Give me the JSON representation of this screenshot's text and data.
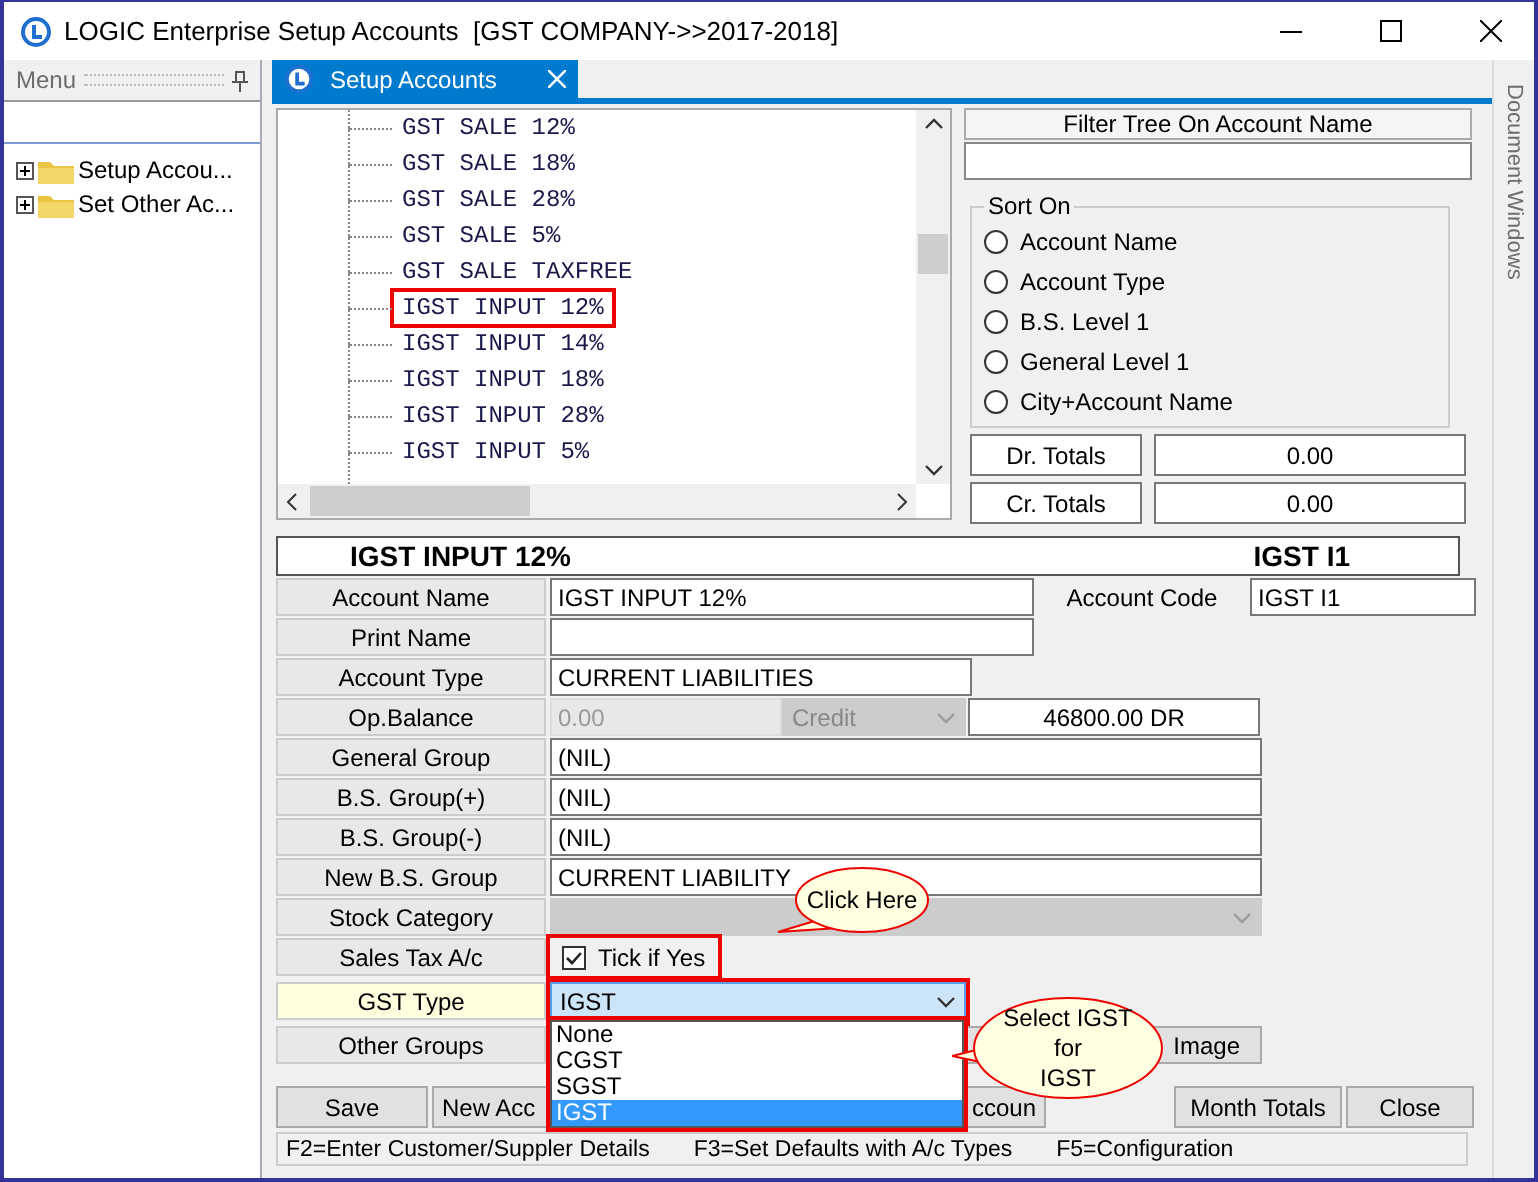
{
  "window": {
    "title": "LOGIC Enterprise Setup Accounts  [GST COMPANY->>2017-2018]"
  },
  "menu_panel": {
    "title": "Menu",
    "items": [
      {
        "label": "Setup Accou...",
        "expanded": false
      },
      {
        "label": "Set Other Ac...",
        "expanded": false
      }
    ]
  },
  "tabs": [
    {
      "label": "Setup Accounts",
      "selected": true
    }
  ],
  "side_strip": "Document Windows",
  "tree": [
    {
      "label": "GST SALE 12%",
      "selected": false
    },
    {
      "label": "GST SALE 18%",
      "selected": false
    },
    {
      "label": "GST SALE 28%",
      "selected": false
    },
    {
      "label": "GST SALE 5%",
      "selected": false
    },
    {
      "label": "GST SALE TAXFREE",
      "selected": false
    },
    {
      "label": "IGST INPUT 12%",
      "selected": true
    },
    {
      "label": "IGST INPUT 14%",
      "selected": false
    },
    {
      "label": "IGST INPUT 18%",
      "selected": false
    },
    {
      "label": "IGST INPUT 28%",
      "selected": false
    },
    {
      "label": "IGST INPUT 5%",
      "selected": false
    }
  ],
  "filter": {
    "label": "Filter Tree On Account Name"
  },
  "sort_on": {
    "title": "Sort On",
    "options": [
      {
        "label": "Account Name",
        "selected": false
      },
      {
        "label": "Account Type",
        "selected": false
      },
      {
        "label": "B.S. Level 1",
        "selected": false
      },
      {
        "label": "General Level 1",
        "selected": false
      },
      {
        "label": "City+Account Name",
        "selected": false
      }
    ]
  },
  "totals": [
    {
      "label": "Dr. Totals",
      "value": "0.00"
    },
    {
      "label": "Cr. Totals",
      "value": "0.00"
    }
  ],
  "header": {
    "name": "IGST INPUT 12%",
    "code": "IGST I1"
  },
  "fields": [
    {
      "kind": "text",
      "label": "Account Name",
      "value": "IGST INPUT 12%",
      "extra_label": "Account Code",
      "extra_value": "IGST I1"
    },
    {
      "kind": "text",
      "label": "Print Name"
    },
    {
      "kind": "text",
      "label": "Account Type",
      "value": "CURRENT LIABILITIES"
    },
    {
      "kind": "balance",
      "label": "Op.Balance",
      "value": "0.00",
      "disabled": true,
      "mode": "Credit",
      "amount": "46800.00 DR"
    },
    {
      "kind": "text",
      "label": "General Group",
      "value": "(NIL)"
    },
    {
      "kind": "text",
      "label": "B.S. Group(+)",
      "value": "(NIL)"
    },
    {
      "kind": "text",
      "label": "B.S. Group(-)",
      "value": "(NIL)"
    },
    {
      "kind": "text",
      "label": "New B.S. Group",
      "value": "CURRENT LIABILITY"
    },
    {
      "kind": "combo",
      "label": "Stock Category",
      "disabled": true
    },
    {
      "kind": "check",
      "label": "Sales Tax A/c",
      "option": "Tick if Yes",
      "checked": true
    },
    {
      "kind": "dropdown",
      "label": "GST Type",
      "value": "IGST",
      "highlighted": true,
      "options": [
        {
          "label": "None",
          "selected": false
        },
        {
          "label": "CGST",
          "selected": false
        },
        {
          "label": "SGST",
          "selected": false
        },
        {
          "label": "IGST",
          "selected": true
        }
      ]
    },
    {
      "kind": "button",
      "label": "Other Groups",
      "button": "Image"
    }
  ],
  "buttons": [
    "Save",
    "New Acc",
    "ccoun",
    "Month Totals",
    "Close"
  ],
  "callouts": [
    {
      "lines": [
        "Click Here"
      ]
    },
    {
      "lines": [
        "Select IGST",
        "for",
        "IGST"
      ]
    }
  ],
  "status_bar": [
    "F2=Enter Customer/Suppler Details",
    "F3=Set Defaults with A/c Types",
    "F5=Configuration"
  ]
}
